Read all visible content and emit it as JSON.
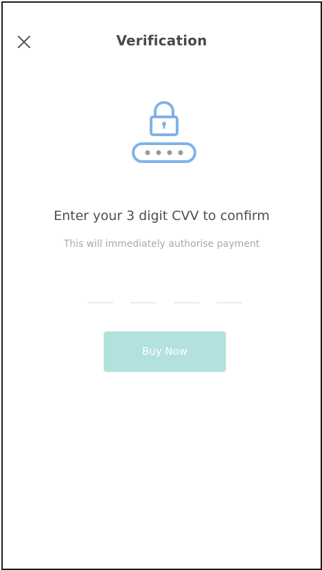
{
  "header": {
    "title": "Verification",
    "close_icon": "close-icon"
  },
  "illustration": {
    "icon": "padlock-password-icon",
    "color": "#7fb3e6"
  },
  "content": {
    "headline": "Enter your 3 digit CVV to confirm",
    "subline": "This will immediately authorise payment"
  },
  "cvv": {
    "slots": [
      "",
      "",
      "",
      ""
    ]
  },
  "actions": {
    "buy_label": "Buy Now",
    "buy_color": "#b3e1de"
  }
}
